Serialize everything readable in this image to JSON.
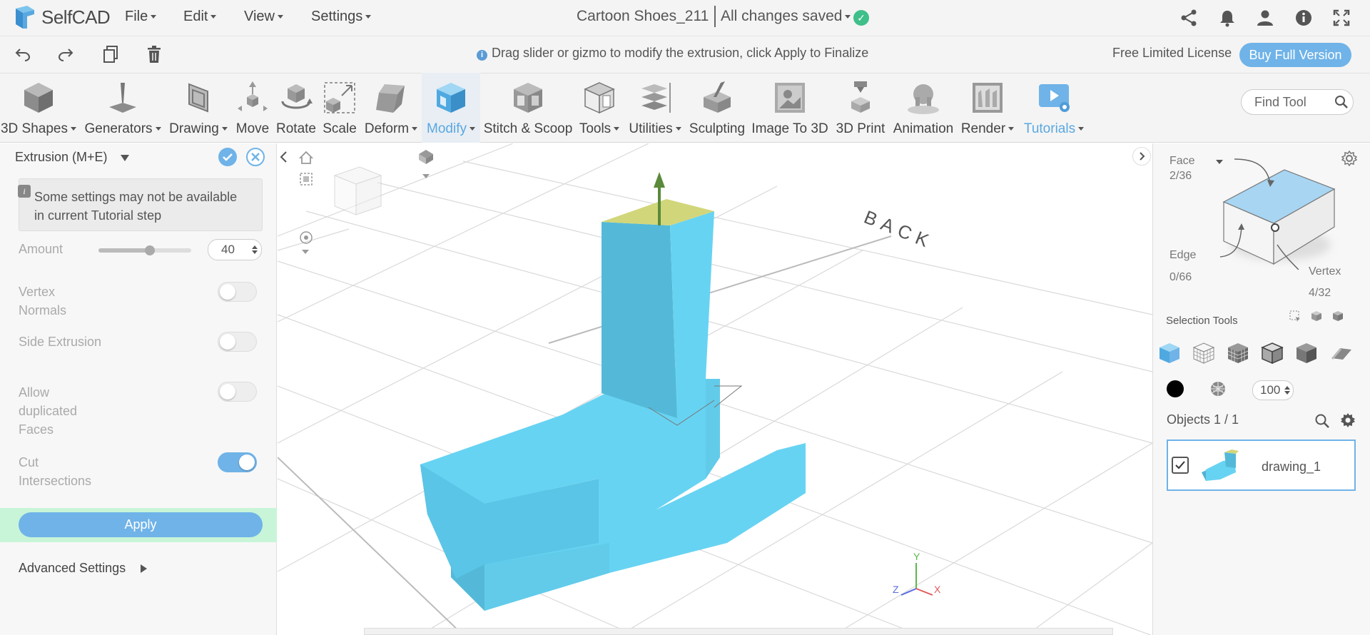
{
  "app": {
    "brand": "SelfCAD",
    "menus": [
      "File",
      "Edit",
      "View",
      "Settings"
    ],
    "document_title": "Cartoon Shoes_211",
    "save_status": "All changes saved"
  },
  "hint": {
    "text": "Drag slider or gizmo to modify the extrusion, click Apply to Finalize"
  },
  "license": {
    "text": "Free Limited License",
    "buy_label": "Buy Full Version"
  },
  "toolbar": {
    "tools": [
      {
        "label": "3D Shapes",
        "dropdown": true
      },
      {
        "label": "Generators",
        "dropdown": true
      },
      {
        "label": "Drawing",
        "dropdown": true
      },
      {
        "label": "Move",
        "dropdown": false
      },
      {
        "label": "Rotate",
        "dropdown": false
      },
      {
        "label": "Scale",
        "dropdown": false
      },
      {
        "label": "Deform",
        "dropdown": true
      },
      {
        "label": "Modify",
        "dropdown": true
      },
      {
        "label": "Stitch & Scoop",
        "dropdown": false
      },
      {
        "label": "Tools",
        "dropdown": true
      },
      {
        "label": "Utilities",
        "dropdown": true
      },
      {
        "label": "Sculpting",
        "dropdown": false
      },
      {
        "label": "Image To 3D",
        "dropdown": false
      },
      {
        "label": "3D Print",
        "dropdown": false
      },
      {
        "label": "Animation",
        "dropdown": false
      },
      {
        "label": "Render",
        "dropdown": true
      },
      {
        "label": "Tutorials",
        "dropdown": true
      }
    ],
    "find_tool_placeholder": "Find Tool"
  },
  "left_panel": {
    "title": "Extrusion (M+E)",
    "notice": "Some settings may not be available in current Tutorial step",
    "amount_label": "Amount",
    "amount_value": "40",
    "amount_fraction": 0.55,
    "settings": [
      {
        "label": "Vertex Normals",
        "on": false
      },
      {
        "label": "Side Extrusion",
        "on": false
      },
      {
        "label": "Allow duplicated Faces",
        "on": false
      },
      {
        "label": "Cut Intersections",
        "on": true
      }
    ],
    "apply_label": "Apply",
    "advanced_label": "Advanced Settings"
  },
  "viewport": {
    "back_label": "BACK",
    "axes": {
      "x": "X",
      "y": "Y",
      "z": "Z"
    },
    "colors": {
      "shape": "#67d3f2",
      "shape_dark": "#54b9d8",
      "selected_face": "#d2d67a",
      "gizmo": "#5a8a3a"
    }
  },
  "right_panel": {
    "face_label": "Face",
    "face_count": "2/36",
    "edge_label": "Edge",
    "edge_count": "0/66",
    "vertex_label": "Vertex",
    "vertex_count": "4/32",
    "selection_tools_label": "Selection Tools",
    "opacity_value": "100",
    "objects_label": "Objects 1 / 1",
    "object_name": "drawing_1"
  },
  "colors": {
    "accent": "#6fb3e8",
    "apply_row_bg": "#c8f5d8",
    "saved_check": "#3fbf8a"
  }
}
